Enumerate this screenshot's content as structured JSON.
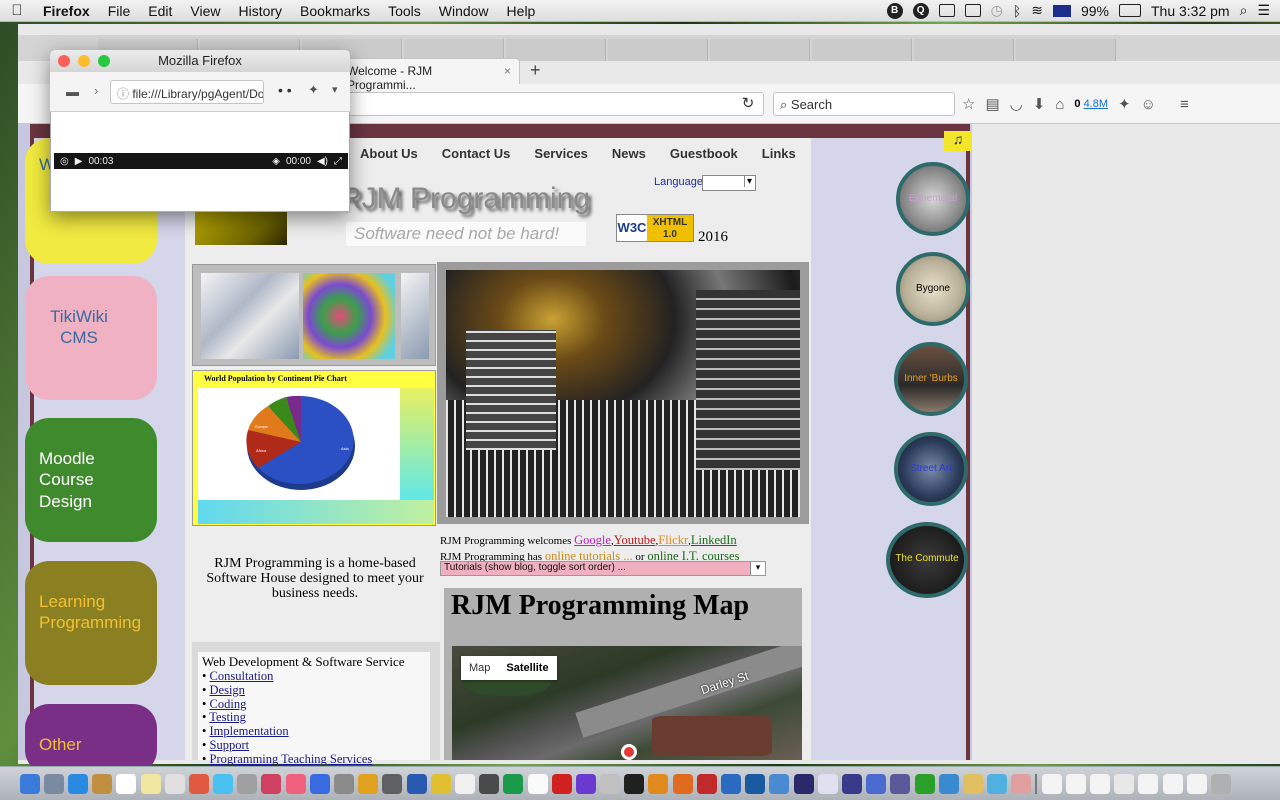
{
  "menubar": {
    "apple": "",
    "app": "Firefox",
    "items": [
      "File",
      "Edit",
      "View",
      "History",
      "Bookmarks",
      "Tools",
      "Window",
      "Help"
    ],
    "battery": "99%",
    "clock": "Thu 3:32 pm"
  },
  "popup": {
    "title": "Mozilla Firefox",
    "url": "file:///Library/pgAgent/Dov",
    "elapsed": "00:03",
    "remaining": "00:00"
  },
  "browser": {
    "active_tab": "Welcome - RJM Programmi...",
    "tab_close": "×",
    "new_tab": "+",
    "search_placeholder": "Search",
    "addon_count": "0",
    "addon_size": "4.8M"
  },
  "site": {
    "nav": [
      "About Us",
      "Contact Us",
      "Services",
      "News",
      "Guestbook",
      "Links"
    ],
    "language_label": "Language",
    "title": "RJM Programming",
    "tagline": "Software need not be hard!",
    "badge_w3c": "W3C",
    "badge_xhtml": "XHTML 1.0",
    "year": "2016",
    "sidebar": [
      {
        "label": "W",
        "color": "#f1ea40"
      },
      {
        "label": "TikiWiki CMS",
        "color": "#f0b2c2"
      },
      {
        "label": "Moodle Course Design",
        "color": "#3f8a2d"
      },
      {
        "label": "Learning Programming",
        "color": "#8a8022"
      },
      {
        "label": "Other",
        "color": "#7a2f86"
      }
    ],
    "pie_title": "World Population by Continent Pie Chart",
    "pie_labels": [
      "Europe",
      "Africa",
      "Asia"
    ],
    "about_text": "RJM Programming is a home-based Software House designed to meet your business needs.",
    "welcome_prefix": "RJM Programming welcomes",
    "welcome_links": [
      "Google",
      "Youtube",
      "Flickr",
      "LinkedIn"
    ],
    "has_prefix": "RJM Programming has",
    "tutorials_link": "online tutorials ...",
    "or_text": "or",
    "courses_link": "online I.T. courses",
    "tutorials_select": "Tutorials (show blog, toggle sort order) ...",
    "services_heading": "Web Development & Software Service",
    "services": [
      "Consultation",
      "Design",
      "Coding",
      "Testing",
      "Implementation",
      "Support",
      "Programming Teaching Services"
    ],
    "map_title": "RJM Programming Map",
    "map_buttons": [
      "Map",
      "Satellite"
    ],
    "street": "Darley St",
    "circles": [
      {
        "label": "Ephemeral",
        "color": "#c4a0d0"
      },
      {
        "label": "Bygone",
        "color": "#000"
      },
      {
        "label": "Inner 'Burbs",
        "color": "#e8a020"
      },
      {
        "label": "Street Art",
        "color": "#2a3ad0"
      },
      {
        "label": "The Commute",
        "color": "#f0e020"
      }
    ]
  },
  "colors": {
    "page_border": "#6a3541",
    "banner_yellow": "#ffff40",
    "circle_border": "#2e6a6a"
  }
}
